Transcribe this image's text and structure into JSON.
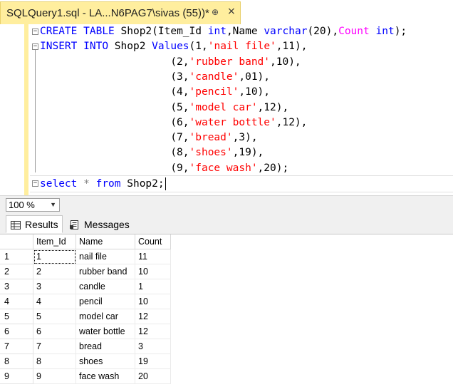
{
  "window": {
    "tab_title": "SQLQuery1.sql - LA...N6PAG7\\sivas (55))*",
    "pin_glyph": "⊕",
    "close_glyph": "×"
  },
  "editor": {
    "lines": [
      [
        {
          "t": "CREATE",
          "c": "kw"
        },
        {
          "t": " "
        },
        {
          "t": "TABLE",
          "c": "kw"
        },
        {
          "t": " Shop2(Item_Id "
        },
        {
          "t": "int",
          "c": "kw"
        },
        {
          "t": ",Name "
        },
        {
          "t": "varchar",
          "c": "kw"
        },
        {
          "t": "(20),"
        },
        {
          "t": "Count",
          "c": "fn"
        },
        {
          "t": " "
        },
        {
          "t": "int",
          "c": "kw"
        },
        {
          "t": ");"
        }
      ],
      [
        {
          "t": "INSERT",
          "c": "kw"
        },
        {
          "t": " "
        },
        {
          "t": "INTO",
          "c": "kw"
        },
        {
          "t": " Shop2 "
        },
        {
          "t": "Values",
          "c": "kw"
        },
        {
          "t": "(1,"
        },
        {
          "t": "'nail file'",
          "c": "str"
        },
        {
          "t": ",11),"
        }
      ],
      [
        {
          "t": "                     (2,"
        },
        {
          "t": "'rubber band'",
          "c": "str"
        },
        {
          "t": ",10),"
        }
      ],
      [
        {
          "t": "                     (3,"
        },
        {
          "t": "'candle'",
          "c": "str"
        },
        {
          "t": ",01),"
        }
      ],
      [
        {
          "t": "                     (4,"
        },
        {
          "t": "'pencil'",
          "c": "str"
        },
        {
          "t": ",10),"
        }
      ],
      [
        {
          "t": "                     (5,"
        },
        {
          "t": "'model car'",
          "c": "str"
        },
        {
          "t": ",12),"
        }
      ],
      [
        {
          "t": "                     (6,"
        },
        {
          "t": "'water bottle'",
          "c": "str"
        },
        {
          "t": ",12),"
        }
      ],
      [
        {
          "t": "                     (7,"
        },
        {
          "t": "'bread'",
          "c": "str"
        },
        {
          "t": ",3),"
        }
      ],
      [
        {
          "t": "                     (8,"
        },
        {
          "t": "'shoes'",
          "c": "str"
        },
        {
          "t": ",19),"
        }
      ],
      [
        {
          "t": "                     (9,"
        },
        {
          "t": "'face wash'",
          "c": "str"
        },
        {
          "t": ",20);"
        }
      ],
      [
        {
          "t": "select",
          "c": "kw"
        },
        {
          "t": " "
        },
        {
          "t": "*",
          "c": "gray"
        },
        {
          "t": " "
        },
        {
          "t": "from",
          "c": "kw"
        },
        {
          "t": " Shop2;"
        }
      ]
    ]
  },
  "toolbar": {
    "zoom_value": "100 %"
  },
  "result_tabs": {
    "results_label": "Results",
    "messages_label": "Messages"
  },
  "grid": {
    "columns": [
      "Item_Id",
      "Name",
      "Count"
    ],
    "rows": [
      [
        "1",
        "1",
        "nail file",
        "11"
      ],
      [
        "2",
        "2",
        "rubber band",
        "10"
      ],
      [
        "3",
        "3",
        "candle",
        "1"
      ],
      [
        "4",
        "4",
        "pencil",
        "10"
      ],
      [
        "5",
        "5",
        "model car",
        "12"
      ],
      [
        "6",
        "6",
        "water bottle",
        "12"
      ],
      [
        "7",
        "7",
        "bread",
        "3"
      ],
      [
        "8",
        "8",
        "shoes",
        "19"
      ],
      [
        "9",
        "9",
        "face wash",
        "20"
      ]
    ]
  },
  "colors": {
    "tab_accent": "#ffee9e",
    "keyword": "#0000ff",
    "string": "#ff0000",
    "function": "#ff00ff"
  }
}
